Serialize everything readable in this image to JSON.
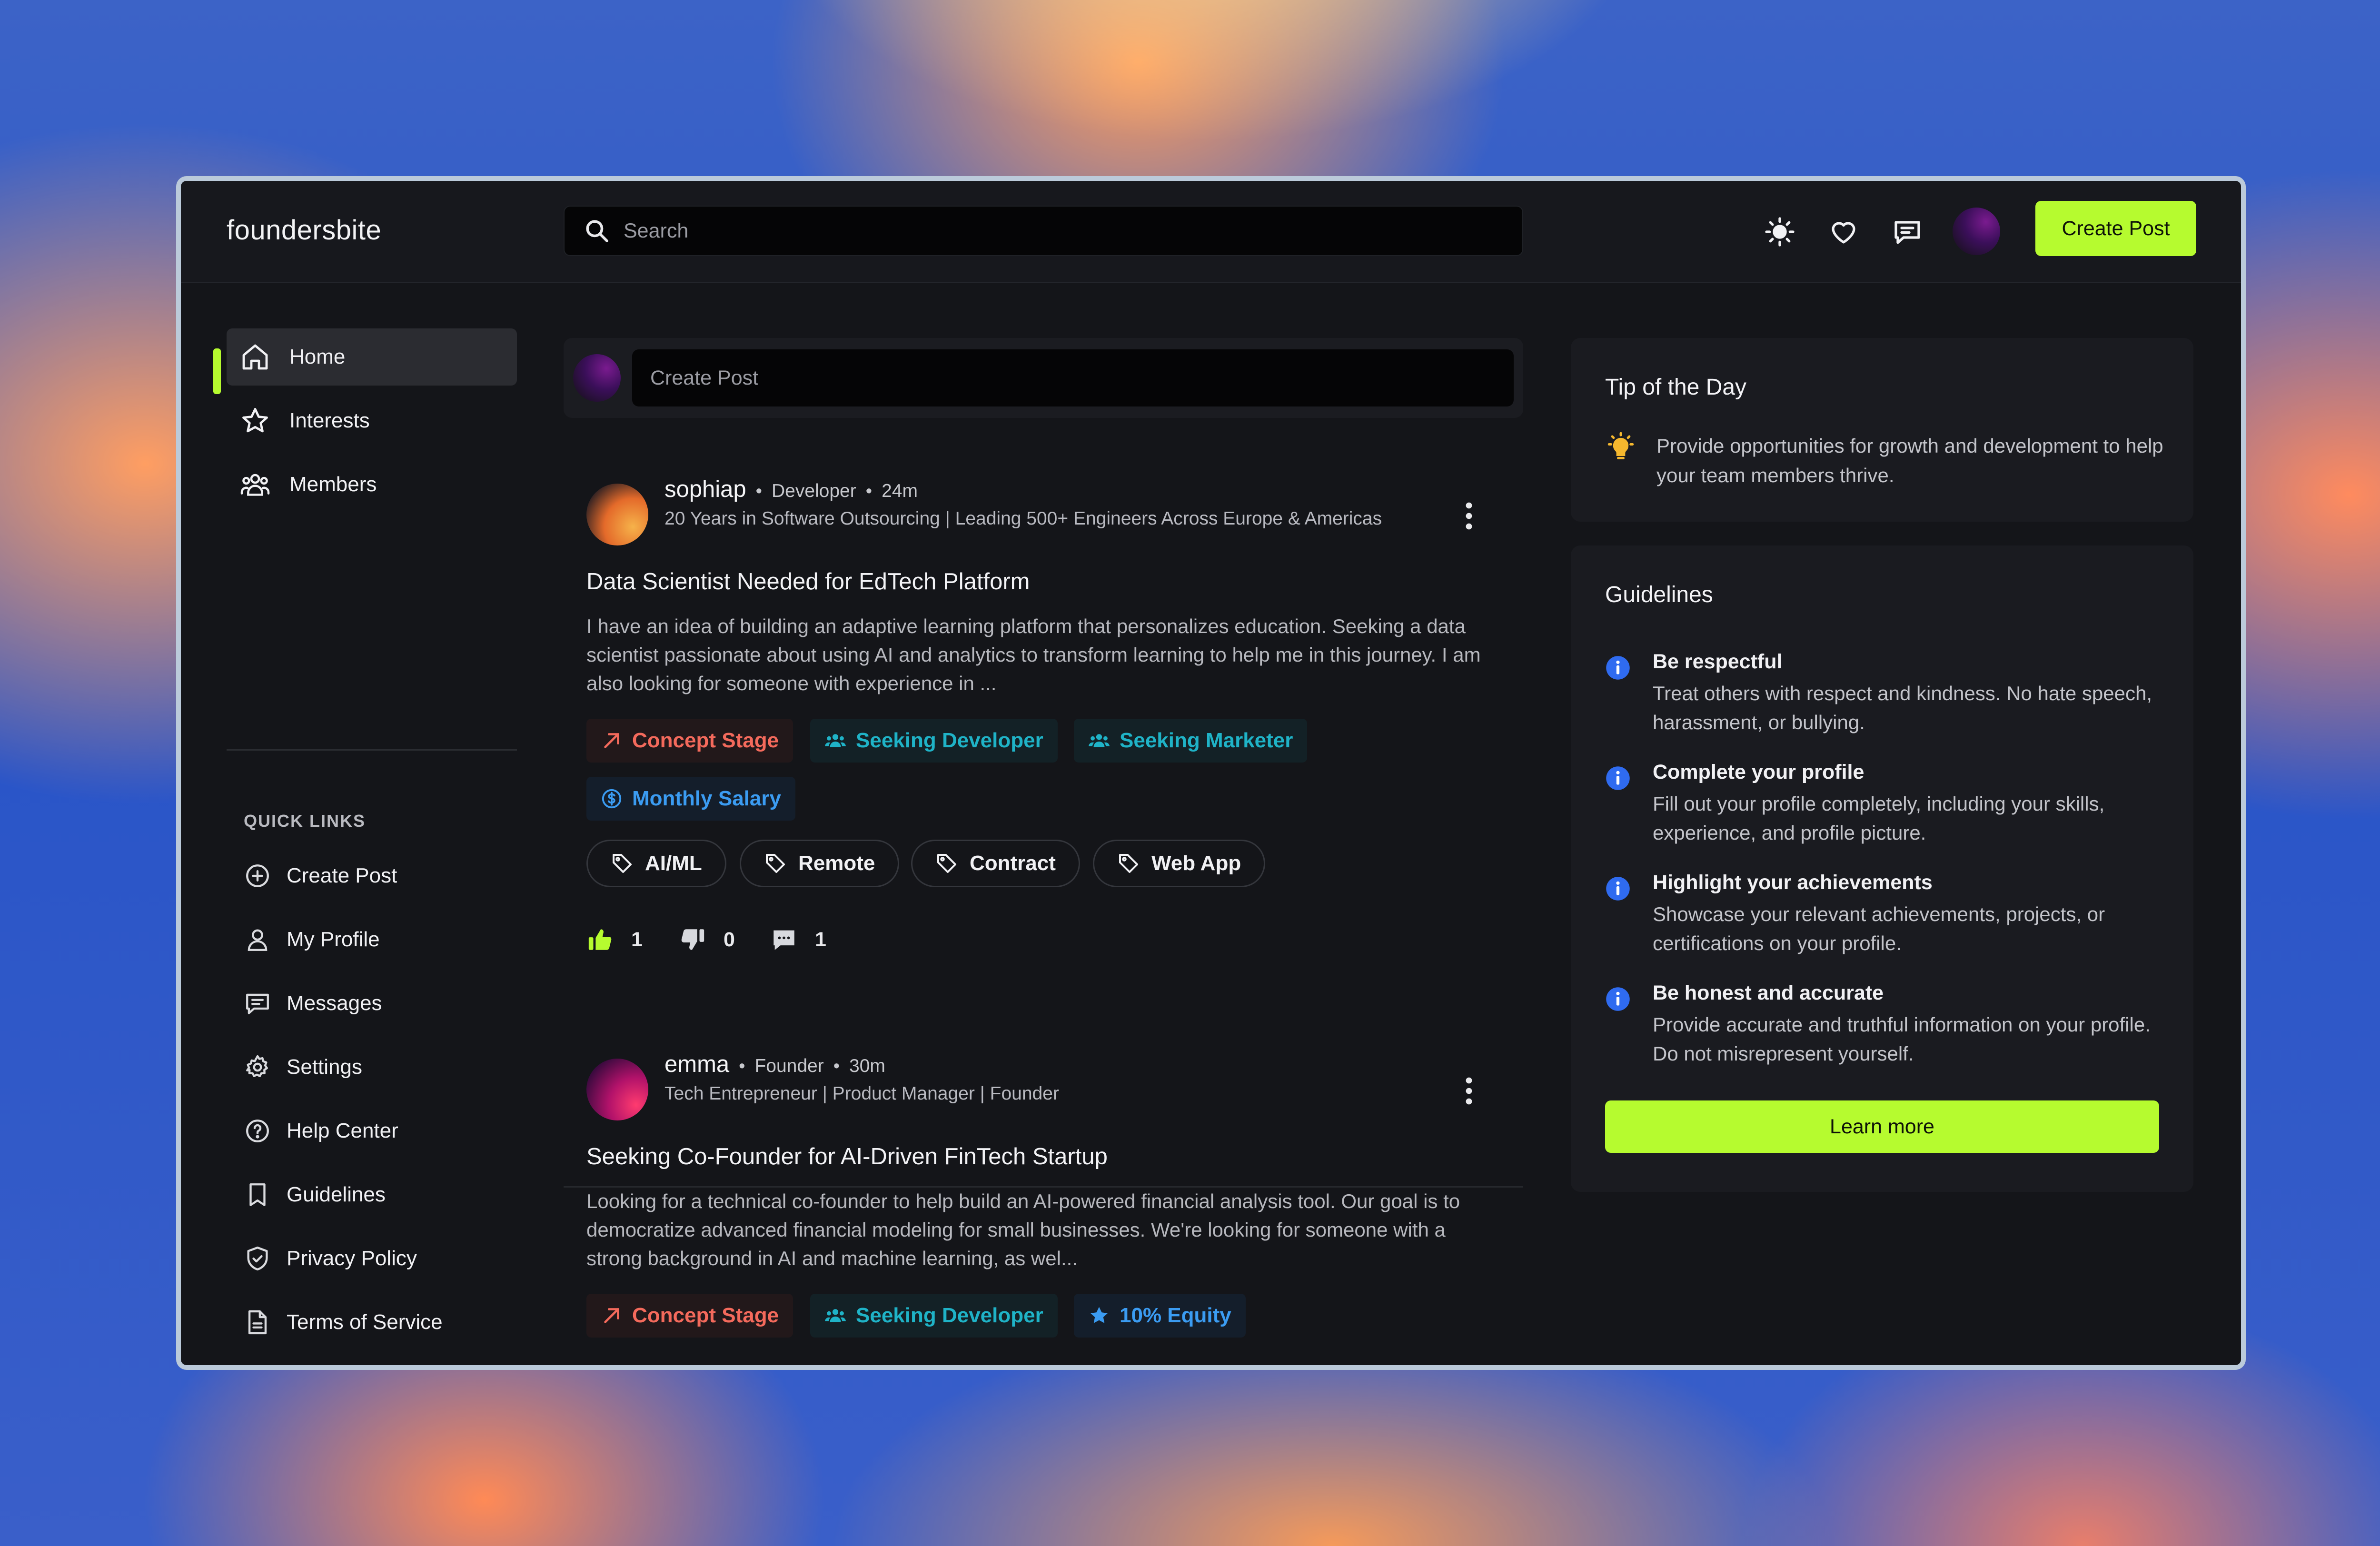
{
  "app": {
    "logo": "foundersbite"
  },
  "topbar": {
    "search_placeholder": "Search",
    "icons": [
      "sun-icon",
      "heart-icon",
      "messages-icon"
    ],
    "create_post_label": "Create Post"
  },
  "sidebar": {
    "nav": [
      {
        "label": "Home",
        "icon": "home-icon",
        "active": true
      },
      {
        "label": "Interests",
        "icon": "star-icon"
      },
      {
        "label": "Members",
        "icon": "members-icon"
      }
    ],
    "quick_links_title": "QUICK LINKS",
    "quick_links": [
      {
        "label": "Create Post",
        "icon": "plus-circle-icon"
      },
      {
        "label": "My Profile",
        "icon": "user-icon"
      },
      {
        "label": "Messages",
        "icon": "message-icon"
      },
      {
        "label": "Settings",
        "icon": "gear-icon"
      },
      {
        "label": "Help Center",
        "icon": "help-icon"
      },
      {
        "label": "Guidelines",
        "icon": "bookmark-icon"
      },
      {
        "label": "Privacy Policy",
        "icon": "shield-icon"
      },
      {
        "label": "Terms of Service",
        "icon": "document-icon"
      }
    ]
  },
  "feed": {
    "compose_placeholder": "Create Post",
    "posts": [
      {
        "author": "sophiap",
        "role": "Developer",
        "time": "24m",
        "headline": "20 Years in Software Outsourcing | Leading 500+ Engineers Across Europe & Americas",
        "title": "Data Scientist Needed for EdTech Platform",
        "body": "I have an idea of building an adaptive learning platform that personalizes education. Seeking a data scientist passionate about using AI and analytics to transform learning to help me in this journey. I am also looking for someone with experience in ...",
        "badges": [
          "Concept Stage",
          "Seeking Developer",
          "Seeking Marketer",
          "Monthly Salary"
        ],
        "tags": [
          "AI/ML",
          "Remote",
          "Contract",
          "Web App"
        ],
        "likes": "1",
        "dislikes": "0",
        "comments": "1"
      },
      {
        "author": "emma",
        "role": "Founder",
        "time": "30m",
        "headline": "Tech Entrepreneur | Product Manager | Founder",
        "title": "Seeking Co-Founder for AI-Driven FinTech Startup",
        "body": "Looking for a technical co-founder to help build an AI-powered financial analysis tool. Our goal is to democratize advanced financial modeling for small businesses. We're looking for someone with a strong background in AI and machine learning, as wel...",
        "badges": [
          "Concept Stage",
          "Seeking Developer",
          "10% Equity"
        ]
      }
    ]
  },
  "tip": {
    "title": "Tip of the Day",
    "text": "Provide opportunities for growth and development to help your team members thrive."
  },
  "guidelines": {
    "title": "Guidelines",
    "items": [
      {
        "head": "Be respectful",
        "text": "Treat others with respect and kindness. No hate speech, harassment, or bullying."
      },
      {
        "head": "Complete your profile",
        "text": "Fill out your profile completely, including your skills, experience, and profile picture."
      },
      {
        "head": "Highlight your achievements",
        "text": "Showcase your relevant achievements, projects, or certifications on your profile."
      },
      {
        "head": "Be honest and accurate",
        "text": "Provide accurate and truthful information on your profile. Do not misrepresent yourself."
      }
    ],
    "learn_more_label": "Learn more"
  },
  "colors": {
    "accent": "#b6fb2f",
    "badge_red": "#f46a5c",
    "badge_teal": "#1fb3c7",
    "badge_blue": "#3b9cf2",
    "info_blue": "#2f6bf0"
  }
}
